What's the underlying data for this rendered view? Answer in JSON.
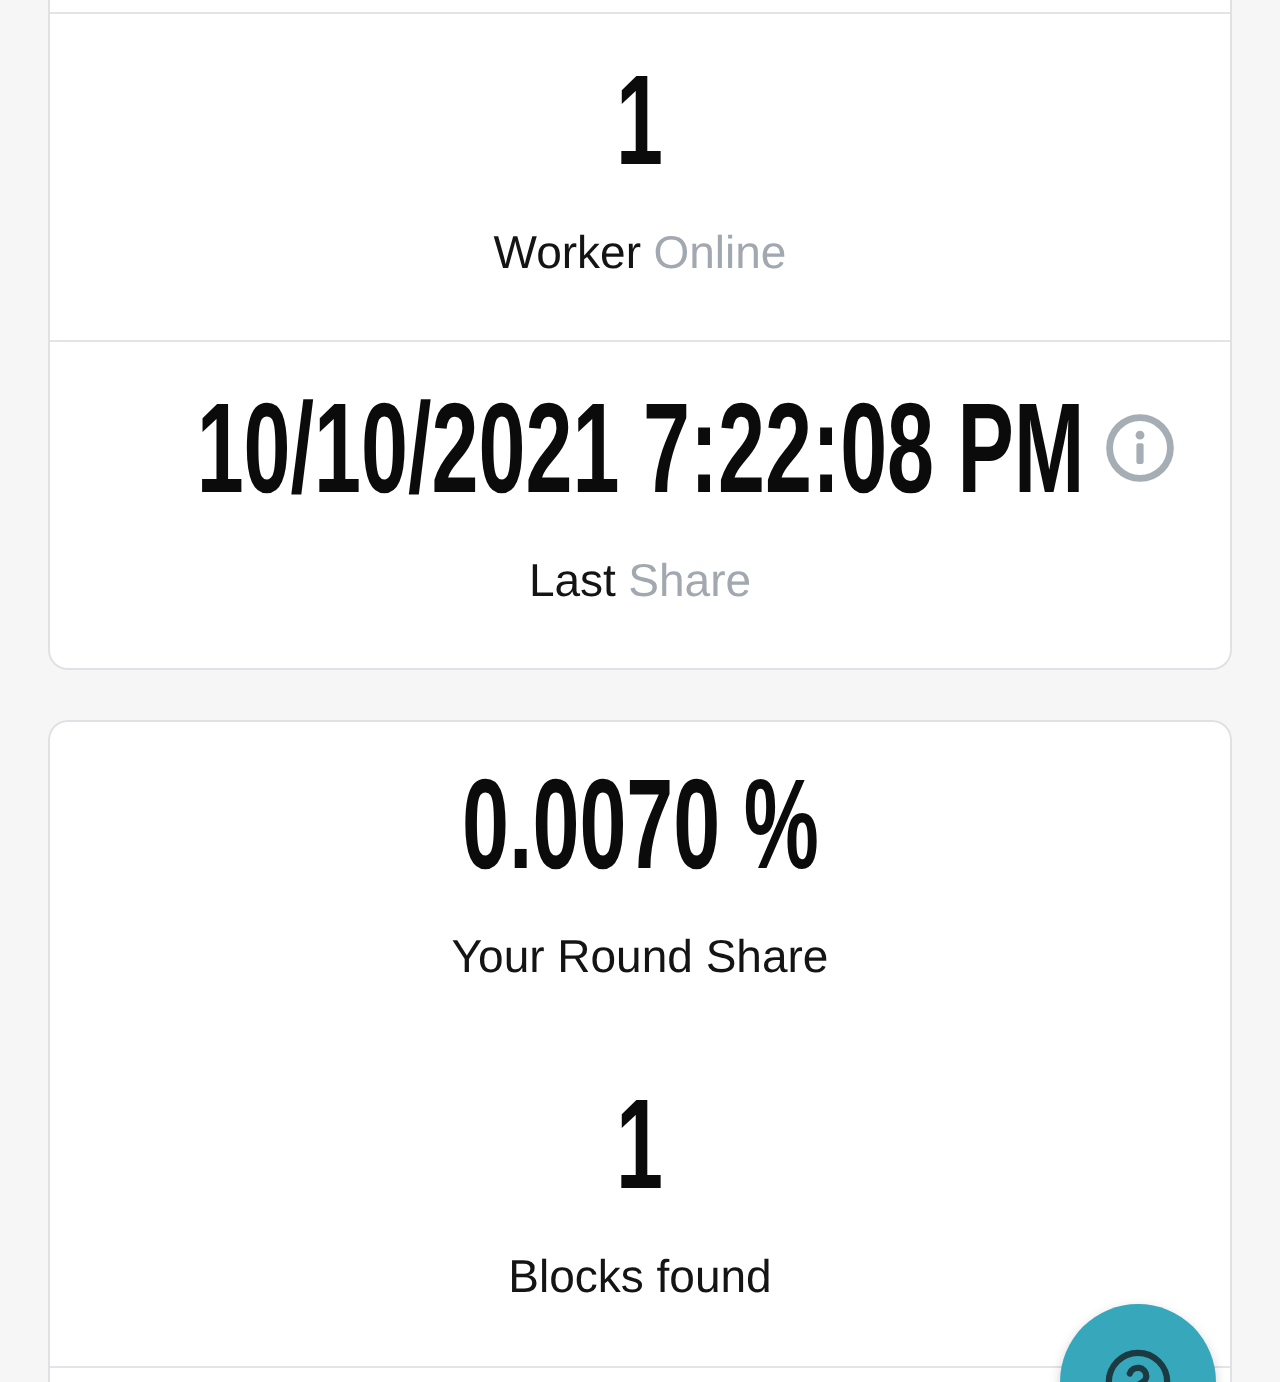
{
  "cards": [
    {
      "dividers": true,
      "stats": [
        {
          "value": "1",
          "label": "Worker",
          "sublabel": "Online",
          "info": false
        },
        {
          "value": "10/10/2021 7:22:08 PM",
          "label": "Last",
          "sublabel": "Share",
          "info": true
        }
      ]
    },
    {
      "dividers": false,
      "stats": [
        {
          "value": "0.0070 %",
          "label": "Your Round Share",
          "info": false
        },
        {
          "value": "1",
          "label": "Blocks found",
          "info": false
        }
      ]
    }
  ]
}
